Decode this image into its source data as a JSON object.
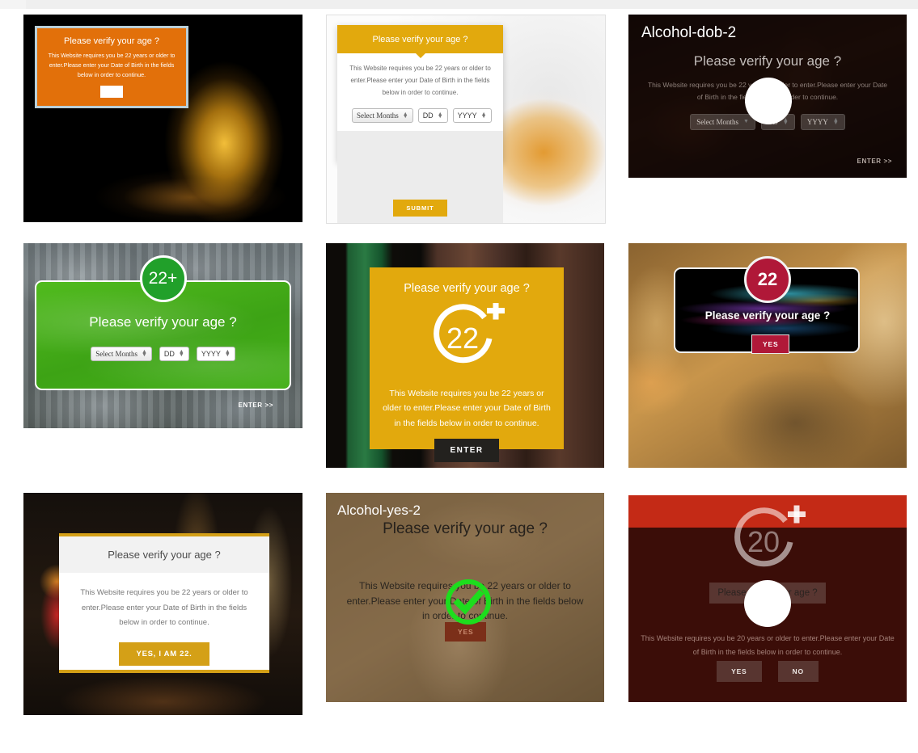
{
  "common": {
    "heading": "Please verify your age ?",
    "body_22": "This Website requires you be 22 years or older to enter.Please enter your Date of Birth in the fields below in order to continue.",
    "body_20": "This Website requires you be 20 years or older to enter.Please enter your Date of Birth in the fields below in order to continue.",
    "select_months": "Select Months",
    "dd": "DD",
    "yyyy": "YYYY",
    "enter_arrow": "ENTER >>"
  },
  "panels": [
    {
      "id": "alcohol-orange-dob",
      "heading": "Please verify your age ?",
      "body": "This Website requires you be 22 years or older to enter.Please enter your Date of Birth in the fields below in order to continue.",
      "button_label": "",
      "accent": "#e2700a",
      "border": "#b9cfd8"
    },
    {
      "id": "alcohol-modal-submit",
      "heading": "Please verify your age ?",
      "body": "This Website requires you be 22 years or older to enter.Please enter your Date of Birth in the fields below in order to continue.",
      "fields": [
        "Select Months",
        "DD",
        "YYYY"
      ],
      "submit_label": "SUBMIT",
      "accent": "#e2a90d"
    },
    {
      "id": "alcohol-dob-2",
      "title": "Alcohol-dob-2",
      "heading": "Please verify your age ?",
      "body": "This Website requires you be 22 years or older to enter.Please enter your Date of Birth in the fields below in order to continue.",
      "fields": [
        "Select Months",
        "DD",
        "YYYY"
      ],
      "enter_label": "ENTER >>",
      "overlay_icon": "check-circle-icon"
    },
    {
      "id": "alcohol-green-dob",
      "badge": "22+",
      "heading": "Please verify your age ?",
      "fields": [
        "Select Months",
        "DD",
        "YYYY"
      ],
      "enter_label": "ENTER >>",
      "accent": "#46b11b",
      "badge_color": "#21a02a"
    },
    {
      "id": "alcohol-yellow-enter",
      "heading": "Please verify your age ?",
      "ring_number": "22",
      "ring_plus": "+",
      "body": "This Website requires you be 22 years or older to enter.Please enter your Date of Birth in the fields below in order to continue.",
      "enter_label": "ENTER",
      "accent": "#e2a90d",
      "button_color": "#23211e"
    },
    {
      "id": "alcohol-dark-yes",
      "badge": "22",
      "heading": "Please verify your age ?",
      "yes_label": "YES",
      "accent": "#b01838"
    },
    {
      "id": "alcohol-white-modal",
      "heading": "Please verify your age ?",
      "body": "This Website requires you be 22 years or older to enter.Please enter your Date of Birth in the fields below in order to continue.",
      "button_label": "YES, I AM 22.",
      "accent": "#d4a017"
    },
    {
      "id": "alcohol-yes-2",
      "title": "Alcohol-yes-2",
      "heading": "Please verify your age ?",
      "body": "This Website requires you be 22 years or older to enter.Please enter your Date of Birth in the fields below in order to continue.",
      "yes_label": "YES",
      "overlay_icon": "check-circle-icon",
      "overlay_color": "#1ddd1d"
    },
    {
      "id": "alcohol-red-yesno",
      "ring_number": "20",
      "ring_plus": "+",
      "heading": "Please verify your age ?",
      "body": "This Website requires you be 20 years or older to enter.Please enter your Date of Birth in the fields below in order to continue.",
      "yes_label": "YES",
      "no_label": "NO",
      "band_color": "#c42a16",
      "body_color": "#3b0d08",
      "overlay_icon": "check-circle-icon"
    }
  ]
}
